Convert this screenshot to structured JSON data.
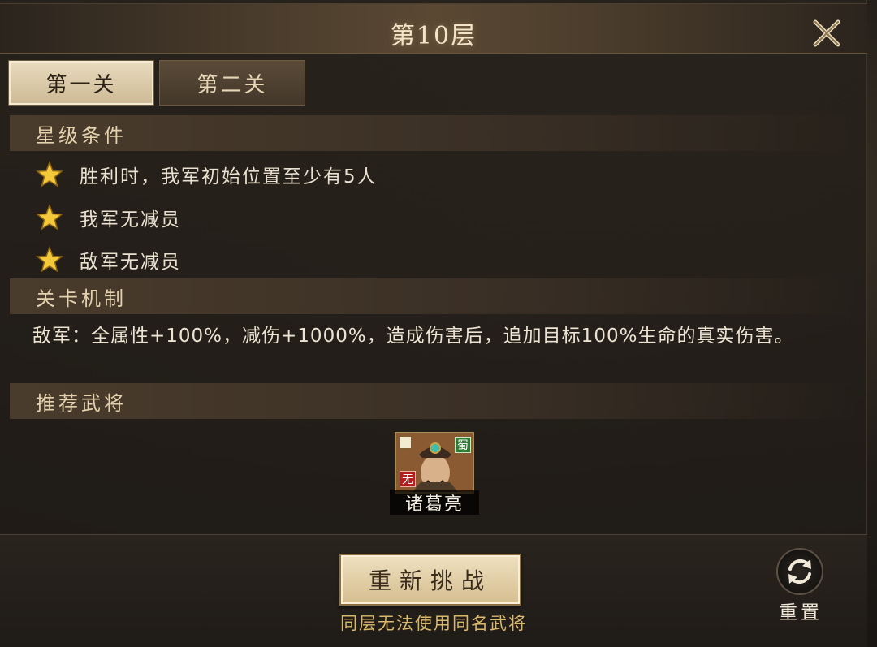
{
  "header": {
    "title": "第10层",
    "close_icon": "close-icon"
  },
  "tabs": [
    {
      "label": "第一关",
      "active": true
    },
    {
      "label": "第二关",
      "active": false
    }
  ],
  "star_conditions": {
    "header": "星级条件",
    "items": [
      {
        "text": "胜利时，我军初始位置至少有5人",
        "icon": "star-icon"
      },
      {
        "text": "我军无减员",
        "icon": "star-icon"
      },
      {
        "text": "敌军无减员",
        "icon": "star-icon"
      }
    ]
  },
  "mechanics": {
    "header": "关卡机制",
    "text": "敌军：全属性+100%，减伤+1000%，造成伤害后，追加目标100%生命的真实伤害。"
  },
  "recommended": {
    "header": "推荐武将",
    "heroes": [
      {
        "name": "诸葛亮",
        "faction_badge": "蜀",
        "type_badge": "无"
      }
    ]
  },
  "footer": {
    "retry_label": "重新挑战",
    "hint": "同层无法使用同名武将",
    "reset_label": "重置"
  },
  "colors": {
    "accent_gold": "#d9b86b",
    "tab_active": "#e9dcc0",
    "panel_bg": "#28221c",
    "star": "#f3c93b"
  }
}
